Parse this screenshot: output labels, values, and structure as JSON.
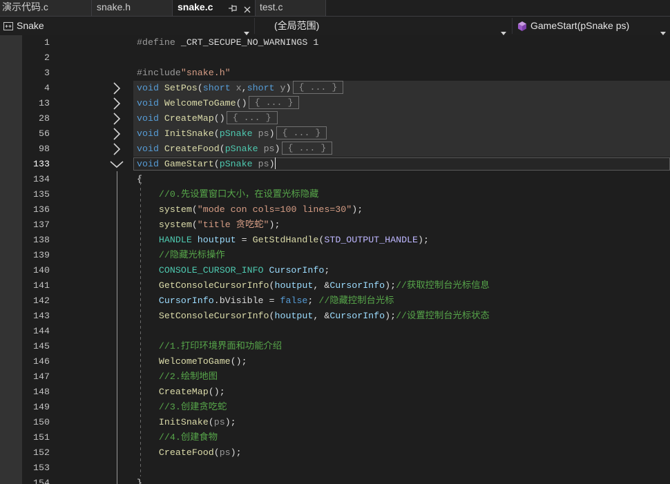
{
  "tabs": [
    {
      "label": "演示代码.c"
    },
    {
      "label": "snake.h"
    },
    {
      "label": "snake.c",
      "active": true,
      "icons": [
        "pin-icon",
        "close-icon"
      ]
    },
    {
      "label": "test.c"
    }
  ],
  "navbar": {
    "project": {
      "icon": "cpp-project-icon",
      "label": "Snake"
    },
    "scope": {
      "label": "(全局范围)"
    },
    "member": {
      "icon": "method-cube-icon",
      "label": "GameStart(pSnake ps)"
    }
  },
  "colors": {
    "keyword": "#569cd6",
    "preprocessor": "#9b9b9b",
    "macro": "#beb7ff",
    "string": "#d69d85",
    "function": "#dcdcaa",
    "type": "#4ec9b0",
    "param": "#9a9a9a",
    "variable": "#9cdcfe",
    "comment": "#57a64a",
    "plain": "#dcdcdc"
  },
  "editor": {
    "active_line": 133,
    "fold_placeholder": "{ ... }",
    "lines": [
      {
        "n": 1,
        "t": [
          [
            "#define",
            "preprocessor"
          ],
          [
            " _CRT_SECUPE_NO_WARNINGS 1",
            "plain"
          ]
        ]
      },
      {
        "n": 2,
        "t": []
      },
      {
        "n": 3,
        "t": [
          [
            "#include",
            "preprocessor"
          ],
          [
            "\"snake.h\"",
            "string"
          ]
        ]
      },
      {
        "n": 4,
        "fold": "collapsed",
        "t": [
          [
            "void",
            "keyword"
          ],
          [
            " ",
            "plain"
          ],
          [
            "SetPos",
            "function"
          ],
          [
            "(",
            "plain"
          ],
          [
            "short",
            "keyword"
          ],
          [
            " ",
            "plain"
          ],
          [
            "x",
            "param"
          ],
          [
            ",",
            "plain"
          ],
          [
            "short",
            "keyword"
          ],
          [
            " ",
            "plain"
          ],
          [
            "y",
            "param"
          ],
          [
            ")",
            "plain"
          ]
        ]
      },
      {
        "n": 13,
        "fold": "collapsed",
        "t": [
          [
            "void",
            "keyword"
          ],
          [
            " ",
            "plain"
          ],
          [
            "WelcomeToGame",
            "function"
          ],
          [
            "()",
            "plain"
          ]
        ]
      },
      {
        "n": 28,
        "fold": "collapsed",
        "t": [
          [
            "void",
            "keyword"
          ],
          [
            " ",
            "plain"
          ],
          [
            "CreateMap",
            "function"
          ],
          [
            "()",
            "plain"
          ]
        ]
      },
      {
        "n": 56,
        "fold": "collapsed",
        "t": [
          [
            "void",
            "keyword"
          ],
          [
            " ",
            "plain"
          ],
          [
            "InitSnake",
            "function"
          ],
          [
            "(",
            "plain"
          ],
          [
            "pSnake",
            "type"
          ],
          [
            " ",
            "plain"
          ],
          [
            "ps",
            "param"
          ],
          [
            ")",
            "plain"
          ]
        ]
      },
      {
        "n": 98,
        "fold": "collapsed",
        "t": [
          [
            "void",
            "keyword"
          ],
          [
            " ",
            "plain"
          ],
          [
            "CreateFood",
            "function"
          ],
          [
            "(",
            "plain"
          ],
          [
            "pSnake",
            "type"
          ],
          [
            " ",
            "plain"
          ],
          [
            "ps",
            "param"
          ],
          [
            ")",
            "plain"
          ]
        ]
      },
      {
        "n": 133,
        "fold": "expanded",
        "t": [
          [
            "void",
            "keyword"
          ],
          [
            " ",
            "plain"
          ],
          [
            "GameStart",
            "function"
          ],
          [
            "(",
            "plain"
          ],
          [
            "pSnake",
            "type"
          ],
          [
            " ",
            "plain"
          ],
          [
            "ps",
            "param"
          ],
          [
            ")",
            "plain"
          ]
        ]
      },
      {
        "n": 134,
        "t": [
          [
            "{",
            "plain"
          ]
        ]
      },
      {
        "n": 135,
        "t": [
          [
            "    ",
            "plain"
          ],
          [
            "//0.先设置窗口大小，在设置光标隐藏",
            "comment"
          ]
        ]
      },
      {
        "n": 136,
        "t": [
          [
            "    ",
            "plain"
          ],
          [
            "system",
            "function"
          ],
          [
            "(",
            "plain"
          ],
          [
            "\"mode con cols=100 lines=30\"",
            "string"
          ],
          [
            ");",
            "plain"
          ]
        ]
      },
      {
        "n": 137,
        "t": [
          [
            "    ",
            "plain"
          ],
          [
            "system",
            "function"
          ],
          [
            "(",
            "plain"
          ],
          [
            "\"title 贪吃蛇\"",
            "string"
          ],
          [
            ");",
            "plain"
          ]
        ]
      },
      {
        "n": 138,
        "t": [
          [
            "    ",
            "plain"
          ],
          [
            "HANDLE",
            "type"
          ],
          [
            " ",
            "plain"
          ],
          [
            "houtput",
            "variable"
          ],
          [
            " = ",
            "plain"
          ],
          [
            "GetStdHandle",
            "function"
          ],
          [
            "(",
            "plain"
          ],
          [
            "STD_OUTPUT_HANDLE",
            "macro"
          ],
          [
            ");",
            "plain"
          ]
        ]
      },
      {
        "n": 139,
        "t": [
          [
            "    ",
            "plain"
          ],
          [
            "//隐藏光标操作",
            "comment"
          ]
        ]
      },
      {
        "n": 140,
        "t": [
          [
            "    ",
            "plain"
          ],
          [
            "CONSOLE_CURSOR_INFO",
            "type"
          ],
          [
            " ",
            "plain"
          ],
          [
            "CursorInfo",
            "variable"
          ],
          [
            ";",
            "plain"
          ]
        ]
      },
      {
        "n": 141,
        "t": [
          [
            "    ",
            "plain"
          ],
          [
            "GetConsoleCursorInfo",
            "function"
          ],
          [
            "(",
            "plain"
          ],
          [
            "houtput",
            "variable"
          ],
          [
            ", &",
            "plain"
          ],
          [
            "CursorInfo",
            "variable"
          ],
          [
            ");",
            "plain"
          ],
          [
            "//获取控制台光标信息",
            "comment"
          ]
        ]
      },
      {
        "n": 142,
        "t": [
          [
            "    ",
            "plain"
          ],
          [
            "CursorInfo",
            "variable"
          ],
          [
            ".",
            "plain"
          ],
          [
            "bVisible",
            "plain"
          ],
          [
            " = ",
            "plain"
          ],
          [
            "false",
            "keyword"
          ],
          [
            "; ",
            "plain"
          ],
          [
            "//隐藏控制台光标",
            "comment"
          ]
        ]
      },
      {
        "n": 143,
        "t": [
          [
            "    ",
            "plain"
          ],
          [
            "SetConsoleCursorInfo",
            "function"
          ],
          [
            "(",
            "plain"
          ],
          [
            "houtput",
            "variable"
          ],
          [
            ", &",
            "plain"
          ],
          [
            "CursorInfo",
            "variable"
          ],
          [
            ");",
            "plain"
          ],
          [
            "//设置控制台光标状态",
            "comment"
          ]
        ]
      },
      {
        "n": 144,
        "t": []
      },
      {
        "n": 145,
        "t": [
          [
            "    ",
            "plain"
          ],
          [
            "//1.打印环境界面和功能介绍",
            "comment"
          ]
        ]
      },
      {
        "n": 146,
        "t": [
          [
            "    ",
            "plain"
          ],
          [
            "WelcomeToGame",
            "function"
          ],
          [
            "();",
            "plain"
          ]
        ]
      },
      {
        "n": 147,
        "t": [
          [
            "    ",
            "plain"
          ],
          [
            "//2.绘制地图",
            "comment"
          ]
        ]
      },
      {
        "n": 148,
        "t": [
          [
            "    ",
            "plain"
          ],
          [
            "CreateMap",
            "function"
          ],
          [
            "();",
            "plain"
          ]
        ]
      },
      {
        "n": 149,
        "t": [
          [
            "    ",
            "plain"
          ],
          [
            "//3.创建贪吃蛇",
            "comment"
          ]
        ]
      },
      {
        "n": 150,
        "t": [
          [
            "    ",
            "plain"
          ],
          [
            "InitSnake",
            "function"
          ],
          [
            "(",
            "plain"
          ],
          [
            "ps",
            "param"
          ],
          [
            ");",
            "plain"
          ]
        ]
      },
      {
        "n": 151,
        "t": [
          [
            "    ",
            "plain"
          ],
          [
            "//4.创建食物",
            "comment"
          ]
        ]
      },
      {
        "n": 152,
        "t": [
          [
            "    ",
            "plain"
          ],
          [
            "CreateFood",
            "function"
          ],
          [
            "(",
            "plain"
          ],
          [
            "ps",
            "param"
          ],
          [
            ");",
            "plain"
          ]
        ]
      },
      {
        "n": 153,
        "t": []
      },
      {
        "n": 154,
        "t": [
          [
            "}",
            "plain"
          ]
        ]
      }
    ]
  }
}
